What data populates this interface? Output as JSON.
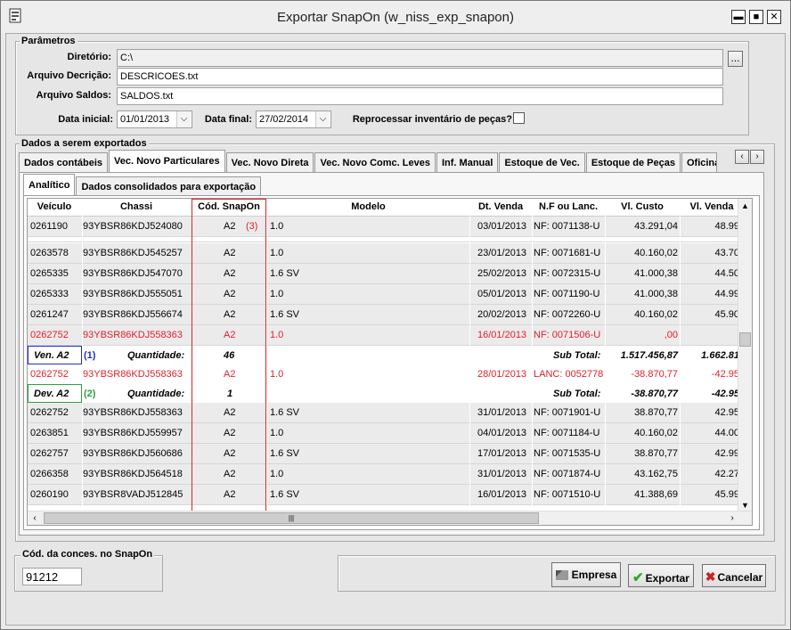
{
  "window": {
    "title": "Exportar SnapOn (w_niss_exp_snapon)"
  },
  "parametros": {
    "legend": "Parâmetros",
    "diretorio_label": "Diretório:",
    "diretorio_value": "C:\\",
    "browse_label": "...",
    "arquivo_decricao_label": "Arquivo Decrição:",
    "arquivo_decricao_value": "DESCRICOES.txt",
    "arquivo_saldos_label": "Arquivo Saldos:",
    "arquivo_saldos_value": "SALDOS.txt",
    "data_inicial_label": "Data inicial:",
    "data_inicial_value": "01/01/2013",
    "data_final_label": "Data final:",
    "data_final_value": "27/02/2014",
    "reprocessar_label": "Reprocessar inventário de peças?"
  },
  "dados": {
    "legend": "Dados a serem exportados",
    "tabs": [
      "Dados contábeis",
      "Vec. Novo Particulares",
      "Vec. Novo Direta",
      "Vec. Novo Comc. Leves",
      "Inf. Manual",
      "Estoque de Vec.",
      "Estoque de Peças",
      "Oficina"
    ],
    "subtabs": [
      "Analítico",
      "Dados consolidados para exportação"
    ],
    "columns": [
      "Veículo",
      "Chassi",
      "Cód. SnapOn",
      "Modelo",
      "Dt. Venda",
      "N.F ou Lanc.",
      "Vl. Custo",
      "Vl. Venda"
    ],
    "rows": [
      {
        "veiculo": "0261190",
        "chassi": "93YBSR86KDJ524080",
        "cod": "A2",
        "modelo": "1.0",
        "dt": "03/01/2013",
        "nf": "NF: 0071138-U",
        "custo": "43.291,04",
        "venda": "48.99"
      },
      {
        "veiculo": "0263578",
        "chassi": "93YBSR86KDJ545257",
        "cod": "A2",
        "modelo": "1.0",
        "dt": "23/01/2013",
        "nf": "NF: 0071681-U",
        "custo": "40.160,02",
        "venda": "43.70"
      },
      {
        "veiculo": "0265335",
        "chassi": "93YBSR86KDJ547070",
        "cod": "A2",
        "modelo": "1.6 SV",
        "dt": "25/02/2013",
        "nf": "NF: 0072315-U",
        "custo": "41.000,38",
        "venda": "44.50"
      },
      {
        "veiculo": "0265333",
        "chassi": "93YBSR86KDJ555051",
        "cod": "A2",
        "modelo": "1.0",
        "dt": "05/01/2013",
        "nf": "NF: 0071190-U",
        "custo": "41.000,38",
        "venda": "44.99"
      },
      {
        "veiculo": "0261247",
        "chassi": "93YBSR86KDJ556674",
        "cod": "A2",
        "modelo": "1.6 SV",
        "dt": "20/02/2013",
        "nf": "NF: 0072260-U",
        "custo": "40.160,02",
        "venda": "45.90"
      },
      {
        "veiculo": "0262752",
        "chassi": "93YBSR86KDJ558363",
        "cod": "A2",
        "modelo": "1.0",
        "dt": "16/01/2013",
        "nf": "NF: 0071506-U",
        "custo": ",00",
        "venda": ""
      },
      {
        "veiculo": "0262752",
        "chassi": "93YBSR86KDJ558363",
        "cod": "A2",
        "modelo": "1.0",
        "dt": "28/01/2013",
        "nf": "LANC: 0052778",
        "custo": "-38.870,77",
        "venda": "-42.95"
      },
      {
        "veiculo": "0262752",
        "chassi": "93YBSR86KDJ558363",
        "cod": "A2",
        "modelo": "1.6 SV",
        "dt": "31/01/2013",
        "nf": "NF: 0071901-U",
        "custo": "38.870,77",
        "venda": "42.95"
      },
      {
        "veiculo": "0263851",
        "chassi": "93YBSR86KDJ559957",
        "cod": "A2",
        "modelo": "1.0",
        "dt": "04/01/2013",
        "nf": "NF: 0071184-U",
        "custo": "40.160,02",
        "venda": "44.00"
      },
      {
        "veiculo": "0262757",
        "chassi": "93YBSR86KDJ560686",
        "cod": "A2",
        "modelo": "1.6 SV",
        "dt": "17/01/2013",
        "nf": "NF: 0071535-U",
        "custo": "38.870,77",
        "venda": "42.99"
      },
      {
        "veiculo": "0266358",
        "chassi": "93YBSR86KDJ564518",
        "cod": "A2",
        "modelo": "1.0",
        "dt": "31/01/2013",
        "nf": "NF: 0071874-U",
        "custo": "43.162,75",
        "venda": "42.27"
      },
      {
        "veiculo": "0260190",
        "chassi": "93YBSR8VADJ512845",
        "cod": "A2",
        "modelo": "1.6 SV",
        "dt": "16/01/2013",
        "nf": "NF: 0071510-U",
        "custo": "41.388,69",
        "venda": "45.99"
      }
    ],
    "annot3": "(3)",
    "ven_group": {
      "label": "Ven. A2",
      "marker": "(1)",
      "qtd_label": "Quantidade:",
      "qtd": "46",
      "subtotal_label": "Sub Total:",
      "custo": "1.517.456,87",
      "venda": "1.662.81"
    },
    "dev_group": {
      "label": "Dev. A2",
      "marker": "(2)",
      "qtd_label": "Quantidade:",
      "qtd": "1",
      "subtotal_label": "Sub Total:",
      "custo": "-38.870,77",
      "venda": "-42.95"
    }
  },
  "conces": {
    "legend": "Cód. da conces. no SnapOn",
    "value": "91212"
  },
  "buttons": {
    "empresa": "Empresa",
    "exportar": "Exportar",
    "cancelar": "Cancelar"
  }
}
